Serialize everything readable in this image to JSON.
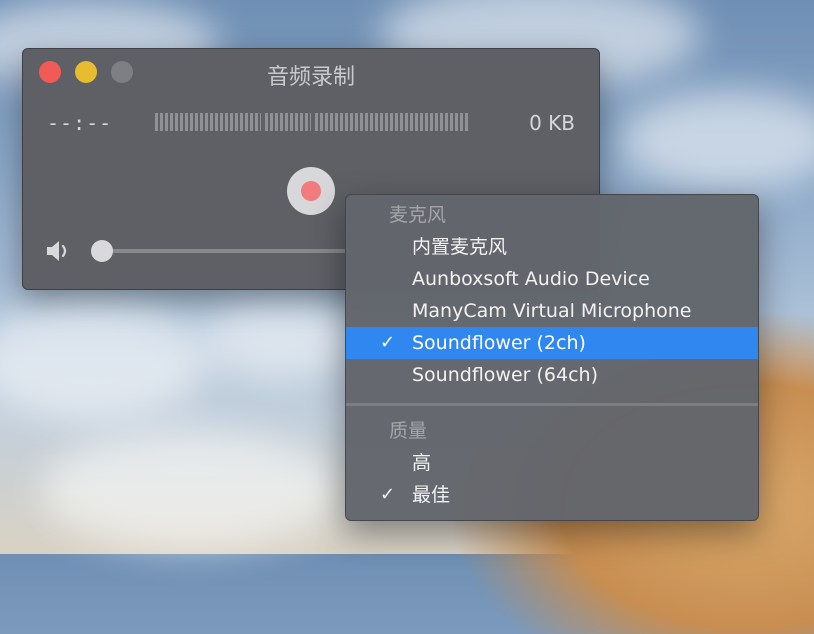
{
  "window": {
    "title": "音频录制",
    "time": "--:--",
    "size": "0 KB"
  },
  "menu": {
    "mic_header": "麦克风",
    "mic_items": [
      {
        "label": "内置麦克风",
        "checked": false
      },
      {
        "label": "Aunboxsoft Audio Device",
        "checked": false
      },
      {
        "label": "ManyCam Virtual Microphone",
        "checked": false
      },
      {
        "label": "Soundflower (2ch)",
        "checked": true
      },
      {
        "label": "Soundflower (64ch)",
        "checked": false
      }
    ],
    "quality_header": "质量",
    "quality_items": [
      {
        "label": "高",
        "checked": false
      },
      {
        "label": "最佳",
        "checked": true
      }
    ],
    "check_glyph": "✓",
    "highlight_color": "#2f87ef"
  },
  "icons": [
    "close-icon",
    "minimize-icon",
    "zoom-icon",
    "record-icon",
    "speaker-icon",
    "checkmark-icon"
  ]
}
